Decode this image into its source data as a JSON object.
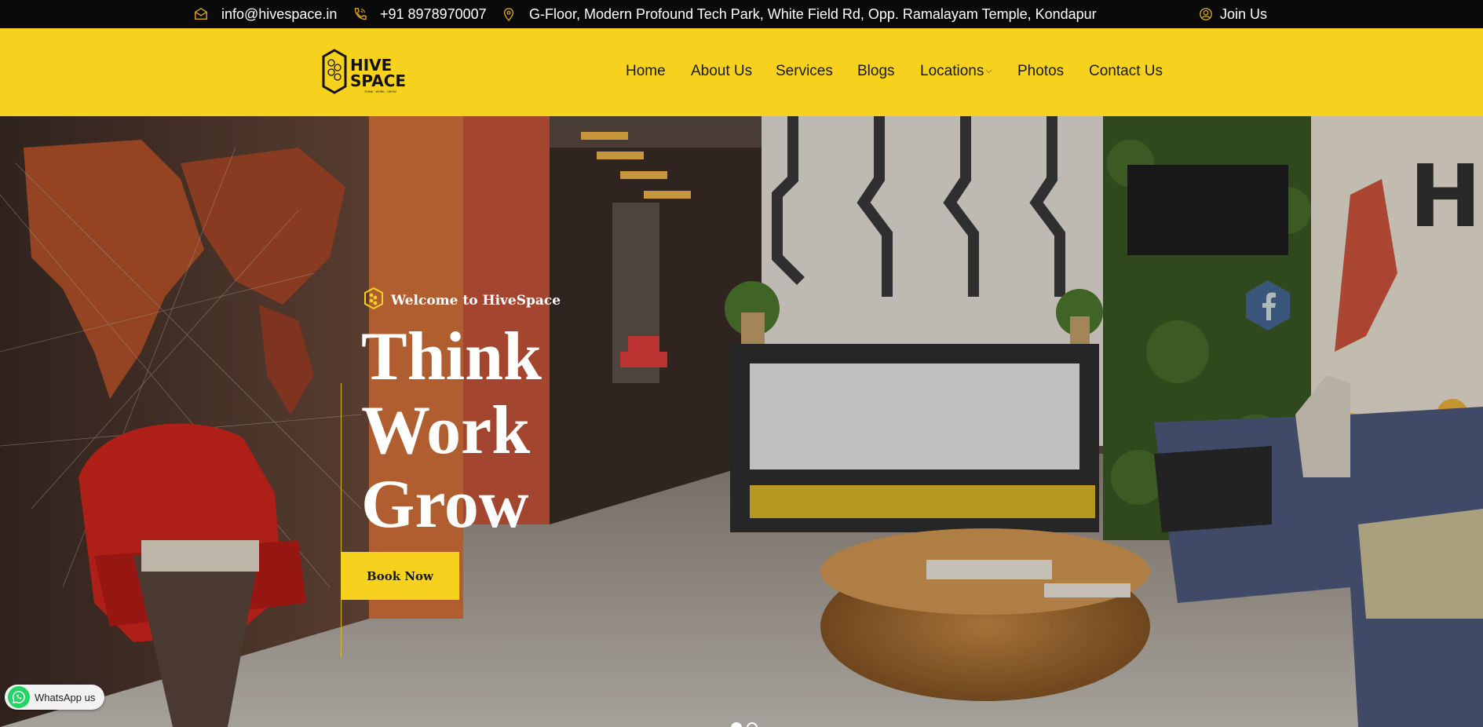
{
  "topbar": {
    "email": "info@hivespace.in",
    "phone": "+91 8978970007",
    "address": "G-Floor, Modern Profound Tech Park, White Field Rd, Opp. Ramalayam Temple, Kondapur",
    "join_label": "Join Us",
    "icons": {
      "email": "mail-icon",
      "phone": "phone-icon",
      "address": "location-pin-icon",
      "join": "user-icon"
    }
  },
  "brand": {
    "logo_alt": "HIVE SPACE",
    "logo_line1": "HIVE",
    "logo_line2": "SPACE",
    "tagline": "THINK . WORK . GROW"
  },
  "nav": {
    "items": [
      {
        "label": "Home"
      },
      {
        "label": "About Us"
      },
      {
        "label": "Services"
      },
      {
        "label": "Blogs"
      },
      {
        "label": "Locations"
      },
      {
        "label": "Photos"
      },
      {
        "label": "Contact Us"
      }
    ],
    "locations_chevron": "⌵"
  },
  "hero": {
    "welcome": "Welcome to HiveSpace",
    "headline": [
      "Think",
      "Work",
      "Grow"
    ],
    "cta_label": "Book Now",
    "slides": 2,
    "active_slide": 1
  },
  "social": {
    "facebook_icon": "facebook-icon"
  },
  "whatsapp": {
    "label": "WhatsApp us"
  },
  "colors": {
    "brand_yellow": "#f6d21e",
    "topbar_bg": "#0a0a0a",
    "whatsapp_green": "#25d366"
  }
}
